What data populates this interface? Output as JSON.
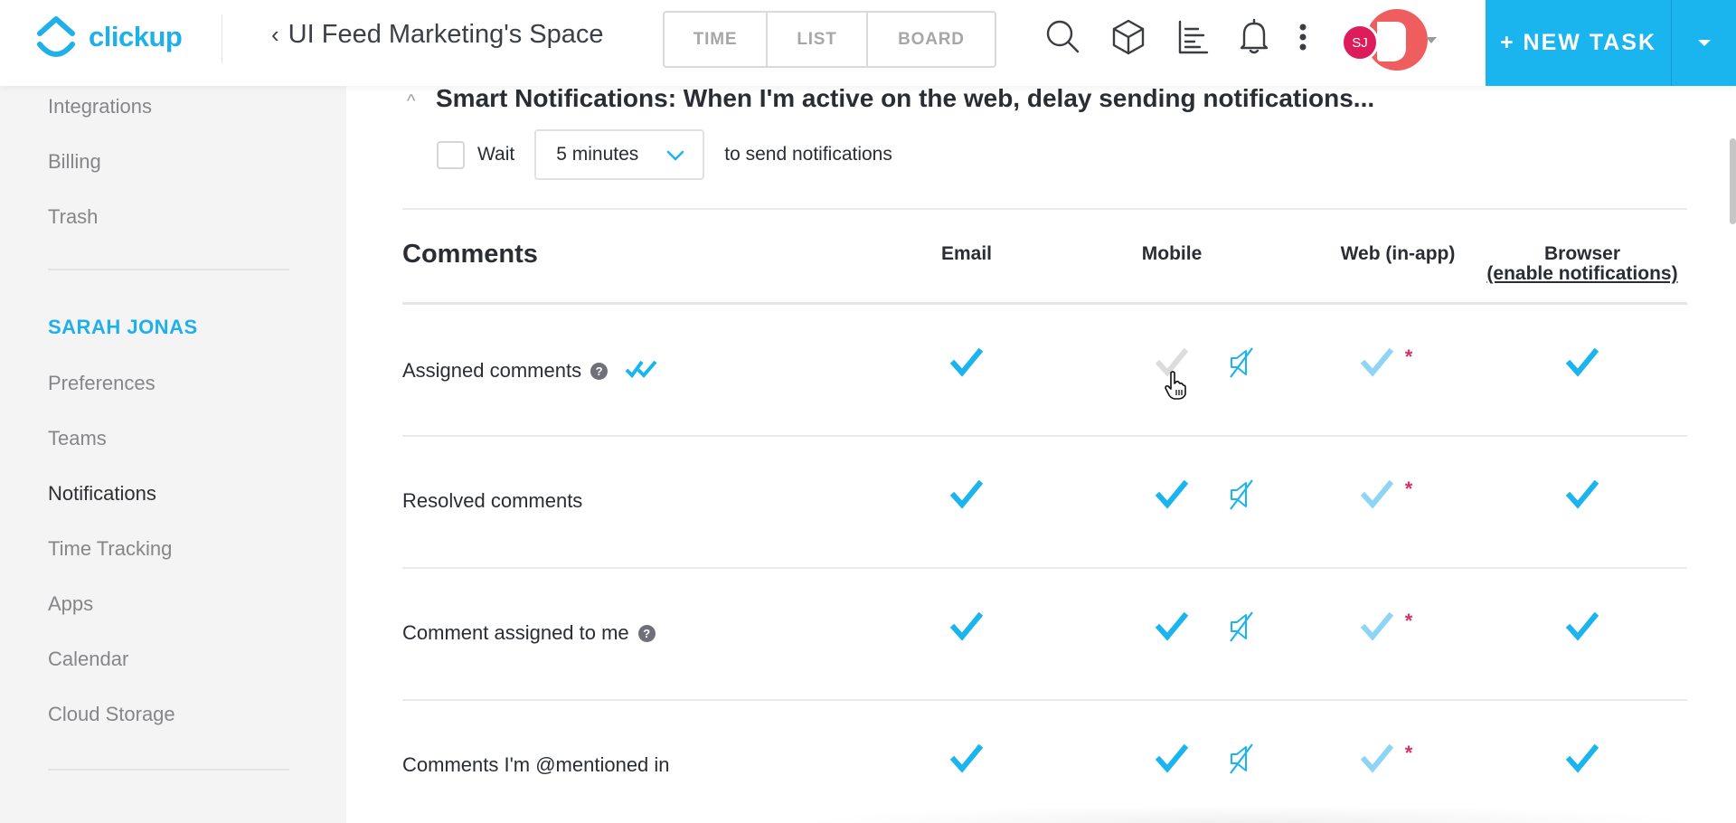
{
  "header": {
    "logo_text": "clickup",
    "back_icon": "chevron-left-icon",
    "space_title": "UI Feed Marketing's Space",
    "view_tabs": [
      {
        "label": "TIME"
      },
      {
        "label": "LIST"
      },
      {
        "label": "BOARD"
      }
    ],
    "icons": [
      "search-icon",
      "box-icon",
      "chart-icon",
      "bell-icon",
      "more-vertical-icon"
    ],
    "avatar_initials": "SJ",
    "new_task_label": "+ NEW TASK",
    "colors": {
      "brand": "#1fb0ea",
      "new_task_bg": "#1ab4ee",
      "avatar_bg": "#dc1c5b",
      "avatar_ring": "#ee5e5e"
    }
  },
  "sidebar": {
    "items_top": [
      {
        "label": "Integrations"
      },
      {
        "label": "Billing"
      },
      {
        "label": "Trash"
      }
    ],
    "user_heading": "SARAH JONAS",
    "items_user": [
      {
        "label": "Preferences"
      },
      {
        "label": "Teams"
      },
      {
        "label": "Notifications",
        "active": true
      },
      {
        "label": "Time Tracking"
      },
      {
        "label": "Apps"
      },
      {
        "label": "Calendar"
      },
      {
        "label": "Cloud Storage"
      }
    ]
  },
  "smart_notifications": {
    "title": "Smart Notifications: When I'm active on the web, delay sending notifications...",
    "wait_checked": false,
    "wait_label": "Wait",
    "delay_value": "5 minutes",
    "suffix_label": "to send notifications"
  },
  "comments_table": {
    "section_title": "Comments",
    "columns": [
      {
        "label": "Email"
      },
      {
        "label": "Mobile"
      },
      {
        "label": "Web (in-app)"
      },
      {
        "label": "Browser",
        "link": "(enable notifications)"
      }
    ],
    "rows": [
      {
        "label": "Assigned comments",
        "help": true,
        "double_check": true,
        "email": true,
        "mobile": false,
        "mobile_muted": true,
        "web": true,
        "web_required": true,
        "browser": true
      },
      {
        "label": "Resolved comments",
        "help": false,
        "double_check": false,
        "email": true,
        "mobile": true,
        "mobile_muted": true,
        "web": true,
        "web_required": true,
        "browser": true
      },
      {
        "label": "Comment assigned to me",
        "help": true,
        "double_check": false,
        "email": true,
        "mobile": true,
        "mobile_muted": true,
        "web": true,
        "web_required": true,
        "browser": true
      },
      {
        "label": "Comments I'm @mentioned in",
        "help": false,
        "double_check": false,
        "email": true,
        "mobile": true,
        "mobile_muted": true,
        "web": true,
        "web_required": true,
        "browser": true
      }
    ],
    "help_glyph": "?",
    "required_glyph": "*",
    "colors": {
      "check_on": "#1ab4ee",
      "check_web": "#8ed5f5",
      "check_off": "#dcdcdc",
      "required": "#d8306a"
    }
  }
}
